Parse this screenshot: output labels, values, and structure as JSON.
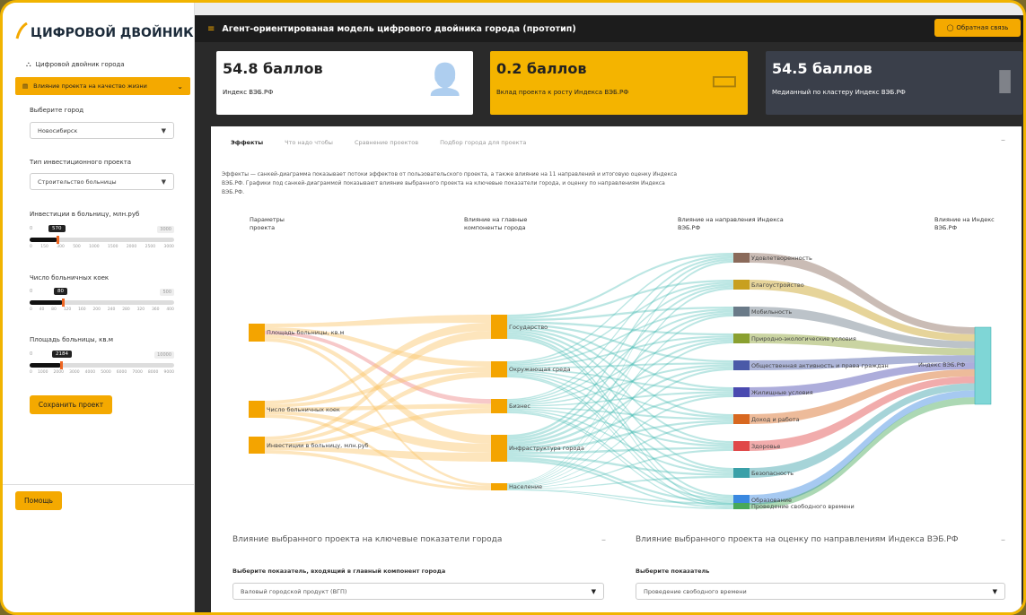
{
  "sidebar": {
    "logo": "ЦИФРОВОЙ ДВОЙНИК",
    "nav_label": "Цифровой двойник города",
    "nav_selected": "Влияние проекта на качество жизни",
    "city_label": "Выберите город",
    "city_value": "Новосибирск",
    "type_label": "Тип инвестиционного проекта",
    "type_value": "Строительство больницы",
    "sliders": [
      {
        "label": "Инвестиции в больницу, млн.руб",
        "min": "0",
        "max": "3000",
        "value": "570",
        "fraction": 0.19,
        "ticks": [
          "0",
          "150",
          "300",
          "500",
          "1000",
          "1500",
          "2000",
          "2500",
          "3000"
        ]
      },
      {
        "label": "Число больничных коек",
        "min": "0",
        "max": "500",
        "value": "80",
        "fraction": 0.23,
        "ticks": [
          "0",
          "40",
          "80",
          "120",
          "160",
          "200",
          "240",
          "280",
          "320",
          "360",
          "400"
        ]
      },
      {
        "label": "Площадь больницы, кв.м",
        "min": "0",
        "max": "10000",
        "value": "2184",
        "fraction": 0.22,
        "ticks": [
          "0",
          "1000",
          "2000",
          "3000",
          "4000",
          "5000",
          "6000",
          "7000",
          "8000",
          "9000"
        ]
      }
    ],
    "save_label": "Сохранить проект",
    "help_label": "Помощь"
  },
  "header": {
    "title": "Агент-ориентированая модель цифрового двойника города (прототип)",
    "feedback_label": "Обратная связь"
  },
  "cards": [
    {
      "value": "54.8 баллов",
      "label": "Индекс ВЭБ.РФ",
      "icon": "person-icon",
      "bg": "#ffffff",
      "fg": "#222222"
    },
    {
      "value": "0.2 баллов",
      "label": "Вклад проекта к росту Индекса ВЭБ.РФ",
      "icon": "money-icon",
      "bg": "#f4b400",
      "fg": "#222222"
    },
    {
      "value": "54.5 баллов",
      "label": "Медианный по кластеру Индекс ВЭБ.РФ",
      "icon": "bar-chart-icon",
      "bg": "#3a3f4a",
      "fg": "#ffffff"
    }
  ],
  "tabs": [
    "Эффекты",
    "Что надо чтобы",
    "Сравнение проектов",
    "Подбор города для проекта"
  ],
  "description": "Эффекты — санкей-диаграмма показывает потоки эффектов от пользовательского проекта, а также влияние на 11 направлений и итоговую оценку Индекса ВЭБ.РФ. Графики под санкей-диаграммой показывают влияние выбранного проекта на ключевые показатели города, и оценку по направлениям Индекса ВЭБ.РФ.",
  "sankey": {
    "col_headers": [
      "Параметры проекта",
      "Влияние на главные компоненты города",
      "Влияние на направления Индекса ВЭБ.РФ",
      "Влияние на Индекс ВЭБ.РФ"
    ],
    "params": [
      "Площадь больницы, кв.м",
      "Число больничных коек",
      "Инвестиции в больницу, млн.руб"
    ],
    "components": [
      "Государство",
      "Окружающая среда",
      "Бизнес",
      "Инфраструктура города",
      "Население"
    ],
    "directions": [
      {
        "name": "Удовлетворенность",
        "color": "#8a6a5a"
      },
      {
        "name": "Благоустройство",
        "color": "#c8a020"
      },
      {
        "name": "Мобильность",
        "color": "#6a7a88"
      },
      {
        "name": "Природно-экологические условия",
        "color": "#8aa030"
      },
      {
        "name": "Общественная активность и права граждан",
        "color": "#4a5aa8"
      },
      {
        "name": "Жилищные условия",
        "color": "#4a4ab0"
      },
      {
        "name": "Доход и работа",
        "color": "#d86820"
      },
      {
        "name": "Здоровье",
        "color": "#e04848"
      },
      {
        "name": "Безопасность",
        "color": "#3aa0a8"
      },
      {
        "name": "Образование",
        "color": "#3a88e0"
      },
      {
        "name": "Проведение свободного времени",
        "color": "#48a858"
      }
    ],
    "final": "Индекс ВЭБ.РФ"
  },
  "panels": [
    {
      "title": "Влияние выбранного проекта на ключевые показатели города",
      "label": "Выберите показатель, входящий в главный компонент города",
      "value": "Валовый городской продукт (ВГП)"
    },
    {
      "title": "Влияние выбранного проекта на оценку по направлениям Индекса ВЭБ.РФ",
      "label": "Выберите показатель",
      "value": "Проведение свободного времени"
    }
  ]
}
